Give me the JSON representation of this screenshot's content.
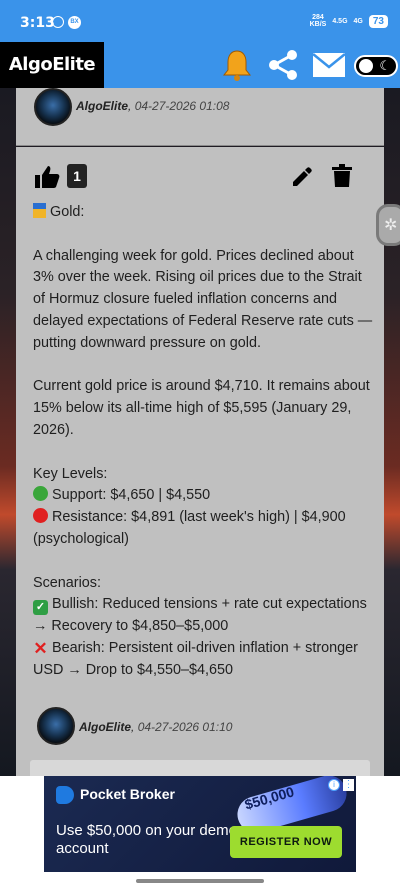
{
  "status_bar": {
    "time": "3:13",
    "speed": "284",
    "speed_unit": "KB/S",
    "net1": "4.5G",
    "net2": "4G",
    "battery": "73",
    "app_badge": "BX"
  },
  "app_bar": {
    "logo": "AlgoElite",
    "icons": [
      "bell-icon",
      "share-icon",
      "mail-icon",
      "theme-toggle"
    ],
    "accent": "#3a93ea"
  },
  "posts": [
    {
      "author": "AlgoElite",
      "date": "04-27-2026 01:08"
    },
    {
      "likes": "1",
      "lines": [
        "Gold:",
        "",
        "A challenging week for gold. Prices declined about 3% over the week. Rising oil prices due to the Strait of Hormuz closure fueled inflation concerns and delayed expectations of Federal Reserve rate cuts —putting downward pressure on gold.",
        "",
        "Current gold price is around $4,710. It remains about 15% below its all-time high of $5,595 (January 29, 2026).",
        "",
        "Key Levels:",
        "Support: $4,650 | $4,550",
        "Resistance: $4,891 (last week's high) | $4,900 (psychological)",
        "",
        "Scenarios:",
        "Bullish: Reduced tensions + rate cut expectations → Recovery to $4,850–$5,000",
        "Bearish: Persistent oil-driven inflation + stronger USD → Drop to $4,550–$4,650"
      ]
    },
    {
      "author": "AlgoElite",
      "date": "04-27-2026 01:10"
    }
  ],
  "ad": {
    "brand": "Pocket Broker",
    "headline": "Use $50,000 on your demo account",
    "amount": "$50,000",
    "cta": "REGISTER NOW"
  }
}
